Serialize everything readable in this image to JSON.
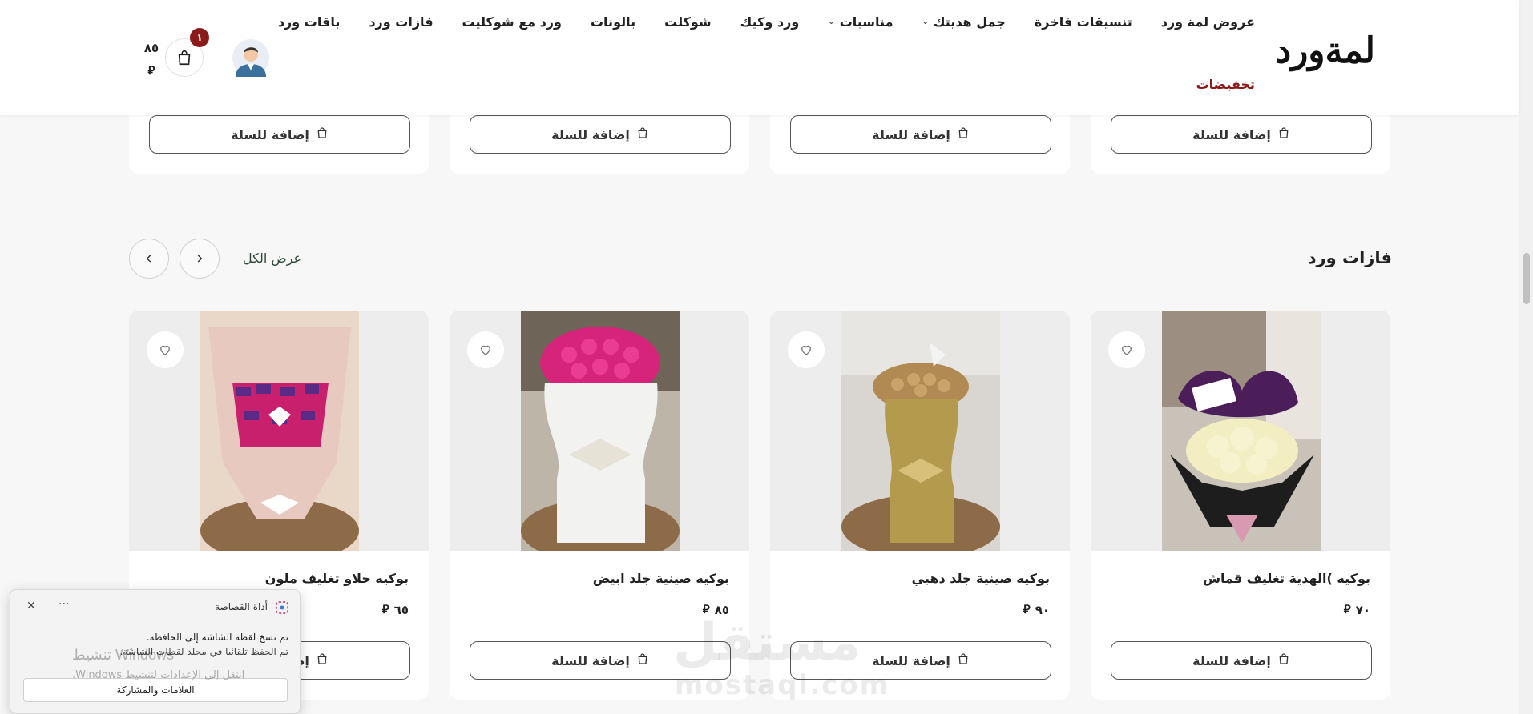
{
  "header": {
    "logo": "لمةورد",
    "nav": [
      {
        "label": "باقات ورد",
        "dropdown": false
      },
      {
        "label": "فازات ورد",
        "dropdown": false
      },
      {
        "label": "ورد مع شوكليت",
        "dropdown": false
      },
      {
        "label": "بالونات",
        "dropdown": false
      },
      {
        "label": "شوكلت",
        "dropdown": false
      },
      {
        "label": "ورد وكيك",
        "dropdown": false
      },
      {
        "label": "مناسبات",
        "dropdown": true
      },
      {
        "label": "جمل هديتك",
        "dropdown": true
      },
      {
        "label": "تنسيقات فاخرة",
        "dropdown": false
      },
      {
        "label": "عروض لمة ورد",
        "dropdown": false
      }
    ],
    "sale": "تخفيضات",
    "cart_count": "١",
    "cart_total": "٨٥",
    "currency": "⃁"
  },
  "add_to_cart": "إضافة للسلة",
  "section": {
    "title": "فازات ورد",
    "view_all": "عرض الكل"
  },
  "products": [
    {
      "name": "بوكيه )الهدية تغليف قماش",
      "price": "٧٠",
      "image": "purple-flowers-bouquet"
    },
    {
      "name": "بوكيه صينية جلد ذهبي",
      "price": "٩٠",
      "image": "gold-chocolate-bouquet"
    },
    {
      "name": "بوكيه صينية جلد ابيض",
      "price": "٨٥",
      "image": "pink-white-bouquet"
    },
    {
      "name": "بوكيه حلاو تغليف ملون",
      "price": "٦٥",
      "image": "candy-bouquet"
    }
  ],
  "toast": {
    "title": "أداة القصاصة",
    "line1": "تم نسخ لقطة الشاشة إلى الحافظة.",
    "line2": "تم الحفظ تلقائيا في مجلد لقطات الشاشة.",
    "button": "العلامات والمشاركة"
  },
  "windows_watermark": {
    "line1": "تنشيط Windows",
    "line2": "انتقل إلى الإعدادات لتنشيط Windows."
  },
  "site_watermark": {
    "arabic": "مستقل",
    "latin": "mostaql.com"
  },
  "colors": {
    "accent": "#8b1a1a",
    "view_all": "#2a4a3a"
  }
}
